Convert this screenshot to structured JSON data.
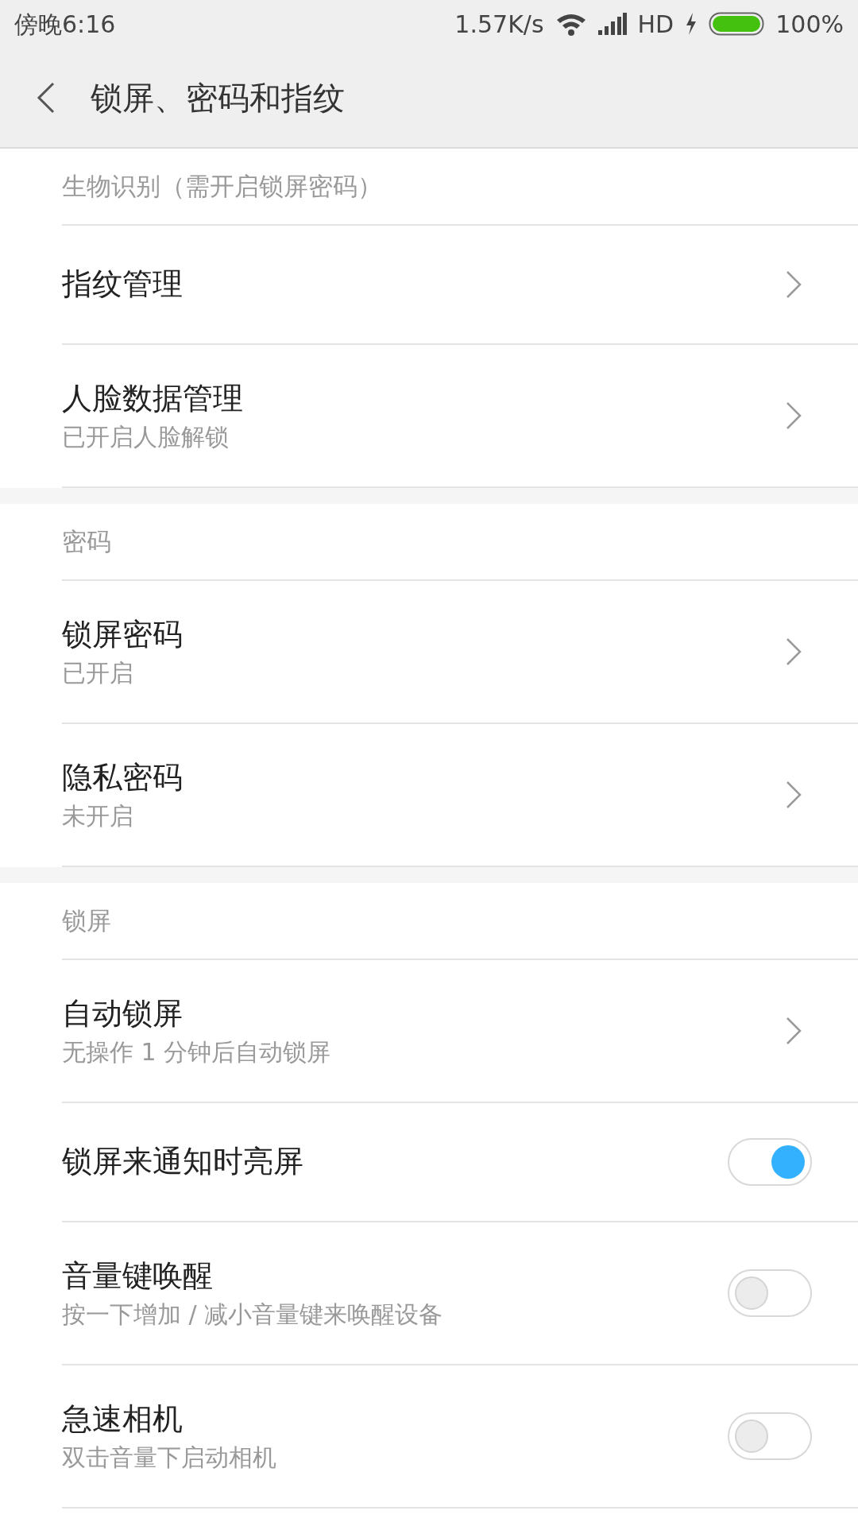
{
  "status_bar": {
    "time": "傍晚6:16",
    "speed": "1.57K/s",
    "network": "HD",
    "battery": "100%"
  },
  "header": {
    "title": "锁屏、密码和指纹"
  },
  "sections": [
    {
      "title": "生物识别（需开启锁屏密码）",
      "items": [
        {
          "kind": "link",
          "title": "指纹管理"
        },
        {
          "kind": "link",
          "title": "人脸数据管理",
          "subtitle": "已开启人脸解锁"
        }
      ]
    },
    {
      "title": "密码",
      "items": [
        {
          "kind": "link",
          "title": "锁屏密码",
          "subtitle": "已开启"
        },
        {
          "kind": "link",
          "title": "隐私密码",
          "subtitle": "未开启"
        }
      ]
    },
    {
      "title": "锁屏",
      "items": [
        {
          "kind": "link",
          "title": "自动锁屏",
          "subtitle": "无操作 1 分钟后自动锁屏"
        },
        {
          "kind": "toggle",
          "title": "锁屏来通知时亮屏",
          "on": true
        },
        {
          "kind": "toggle",
          "title": "音量键唤醒",
          "subtitle": "按一下增加 / 减小音量键来唤醒设备",
          "on": false
        },
        {
          "kind": "toggle",
          "title": "急速相机",
          "subtitle": "双击音量下启动相机",
          "on": false
        }
      ]
    }
  ]
}
